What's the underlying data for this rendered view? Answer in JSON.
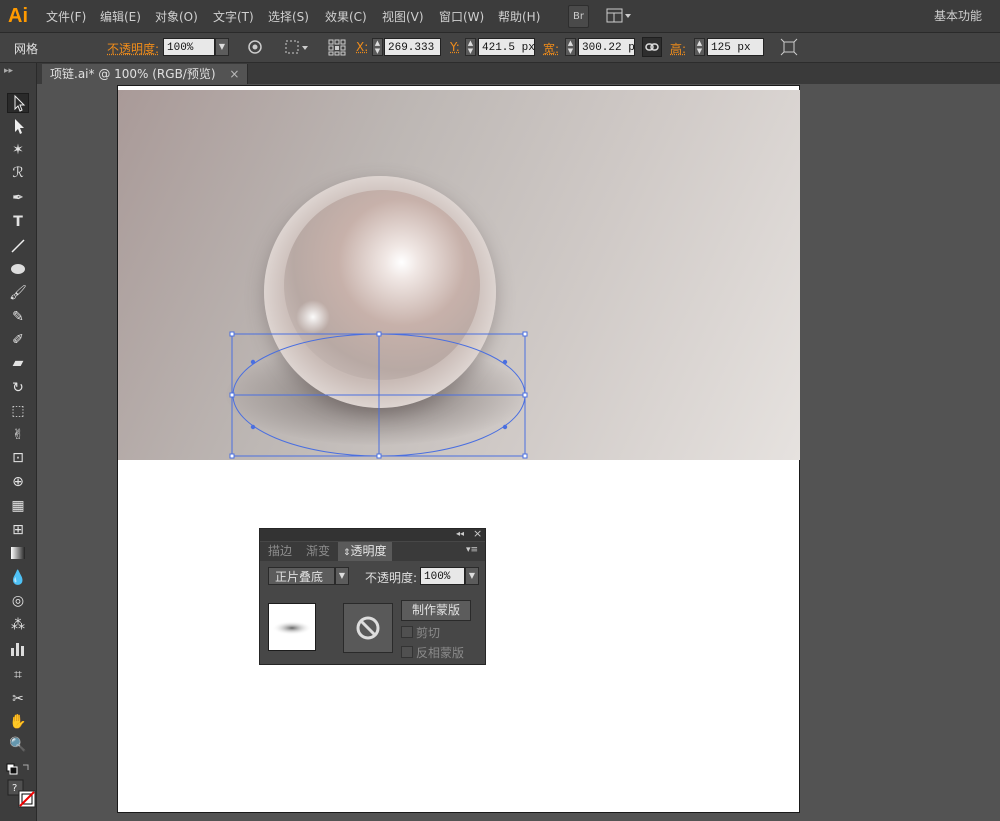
{
  "app": {
    "logo": "Ai"
  },
  "menu": {
    "items": [
      "文件(F)",
      "编辑(E)",
      "对象(O)",
      "文字(T)",
      "选择(S)",
      "效果(C)",
      "视图(V)",
      "窗口(W)",
      "帮助(H)"
    ],
    "bridge_label": "Br",
    "workspace": "基本功能"
  },
  "control": {
    "object_type": "网格",
    "opacity_label": "不透明度:",
    "opacity_value": "100%",
    "x_label": "X:",
    "x_value": "269.333 :",
    "y_label": "Y:",
    "y_value": "421.5 px",
    "w_label": "宽:",
    "w_value": "300.22 p:",
    "h_label": "高:",
    "h_value": "125 px"
  },
  "document": {
    "tab_title": "项链.ai* @ 100% (RGB/预览)",
    "close": "×"
  },
  "panel": {
    "tabs": [
      "描边",
      "渐变",
      "透明度"
    ],
    "active_tab": "透明度",
    "blend_mode": "正片叠底",
    "opacity_label": "不透明度:",
    "opacity_value": "100%",
    "make_mask": "制作蒙版",
    "clip": "剪切",
    "invert_mask": "反相蒙版",
    "collapse": "◂◂",
    "close": "×",
    "menu": "▾≡"
  },
  "colors": {
    "accent": "#f08c1a",
    "selection": "#4a6fe0",
    "logo": "#ff9a00"
  }
}
